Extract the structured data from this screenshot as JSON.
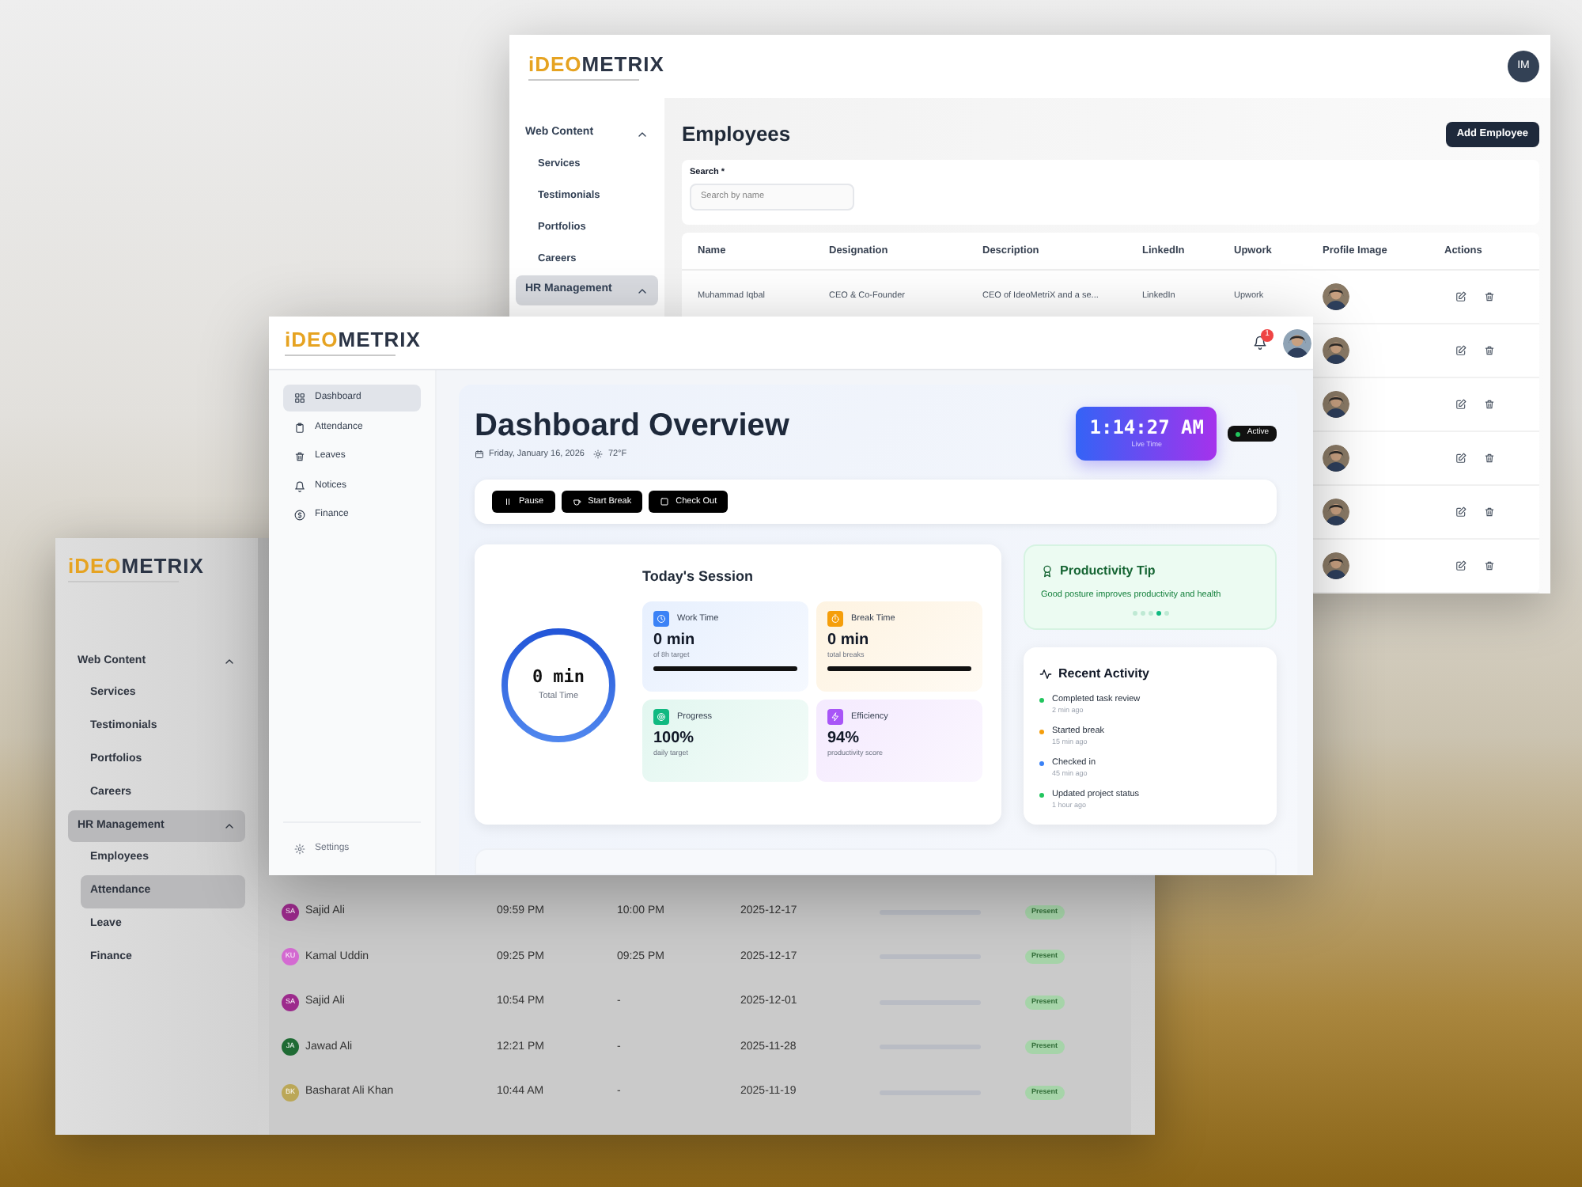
{
  "employees_window": {
    "logo": {
      "accent": "iDEO",
      "text": "METRIX"
    },
    "user_initials": "IM",
    "sidebar": [
      {
        "label": "Web Content",
        "expanded": true,
        "selected": false,
        "children": [
          {
            "label": "Services",
            "selected": false
          },
          {
            "label": "Testimonials",
            "selected": false
          },
          {
            "label": "Portfolios",
            "selected": false
          },
          {
            "label": "Careers",
            "selected": false
          }
        ]
      },
      {
        "label": "HR Management",
        "expanded": true,
        "selected": true
      }
    ],
    "title": "Employees",
    "add_button": "Add Employee",
    "search": {
      "label": "Search *",
      "placeholder": "Search by name"
    },
    "table": {
      "columns": [
        "Name",
        "Designation",
        "Description",
        "LinkedIn",
        "Upwork",
        "Profile Image",
        "Actions"
      ],
      "rows": [
        {
          "name": "Muhammad Iqbal",
          "designation": "CEO & Co-Founder",
          "description": "CEO of IdeoMetriX and a se...",
          "linkedin": "LinkedIn",
          "upwork": "Upwork",
          "profile_image": {
            "kind": "picture"
          }
        },
        {
          "profile_image": {
            "kind": "picture"
          }
        },
        {
          "profile_image": {
            "kind": "picture"
          }
        },
        {
          "profile_image": {
            "kind": "picture"
          }
        },
        {
          "profile_image": {
            "kind": "picture"
          }
        },
        {
          "profile_image": {
            "kind": "picture"
          }
        }
      ]
    }
  },
  "attendance_window": {
    "logo": {
      "accent": "iDEO",
      "text": "METRIX"
    },
    "sidebar": [
      {
        "label": "Web Content",
        "expanded": true,
        "selected": false,
        "children": [
          {
            "label": "Services",
            "selected": false
          },
          {
            "label": "Testimonials",
            "selected": false
          },
          {
            "label": "Portfolios",
            "selected": false
          },
          {
            "label": "Careers",
            "selected": false
          }
        ]
      },
      {
        "label": "HR Management",
        "expanded": true,
        "selected": true,
        "children": [
          {
            "label": "Employees",
            "selected": false
          },
          {
            "label": "Attendance",
            "selected": true
          },
          {
            "label": "Leave",
            "selected": false
          },
          {
            "label": "Finance",
            "selected": false
          }
        ]
      }
    ],
    "rows": [
      {
        "initials": "SA",
        "color": "#9c2a8c",
        "name": "Sajid Ali",
        "check_in": "09:59 PM",
        "check_out": "10:00 PM",
        "date": "2025-12-17",
        "level": 0,
        "status": "Present"
      },
      {
        "initials": "KU",
        "color": "#d46ad2",
        "name": "Kamal Uddin",
        "check_in": "09:25 PM",
        "check_out": "09:25 PM",
        "date": "2025-12-17",
        "level": 0,
        "status": "Present"
      },
      {
        "initials": "SA",
        "color": "#9c2a8c",
        "name": "Sajid Ali",
        "check_in": "10:54 PM",
        "check_out": "-",
        "date": "2025-12-01",
        "level": 0,
        "status": "Present"
      },
      {
        "initials": "JA",
        "color": "#1f6b34",
        "name": "Jawad Ali",
        "check_in": "12:21 PM",
        "check_out": "-",
        "date": "2025-11-28",
        "level": 0,
        "status": "Present"
      },
      {
        "initials": "BK",
        "color": "#bba757",
        "name": "Basharat Ali Khan",
        "check_in": "10:44 AM",
        "check_out": "-",
        "date": "2025-11-19",
        "level": 0,
        "status": "Present"
      }
    ]
  },
  "dashboard_window": {
    "logo": {
      "accent": "iDEO",
      "text": "METRIX"
    },
    "notifications": "1",
    "nav": [
      {
        "label": "Dashboard",
        "selected": true
      },
      {
        "label": "Attendance",
        "selected": false
      },
      {
        "label": "Leaves",
        "selected": false
      },
      {
        "label": "Notices",
        "selected": false
      },
      {
        "label": "Finance",
        "selected": false
      }
    ],
    "settings": "Settings",
    "title": "Dashboard Overview",
    "date": "Friday, January 16, 2026",
    "weather": "72°F",
    "clock": {
      "time": "1:14:27 AM",
      "label": "Live Time"
    },
    "status": {
      "label": "Active",
      "on": true
    },
    "actions": [
      "Pause",
      "Start Break",
      "Check Out"
    ],
    "session": {
      "title": "Today's Session",
      "total": "0 min",
      "total_label": "Total Time",
      "stats": [
        {
          "label": "Work Time",
          "value": "0 min",
          "caption": "of 8h target",
          "level": 1,
          "color": "#3b82f6"
        },
        {
          "label": "Break Time",
          "value": "0 min",
          "caption": "total breaks",
          "level": 1,
          "color": "#f59e0b"
        },
        {
          "label": "Progress",
          "value": "100%",
          "caption": "daily target",
          "color": "#10b981"
        },
        {
          "label": "Efficiency",
          "value": "94%",
          "caption": "productivity score",
          "color": "#a855f7"
        }
      ]
    },
    "tip": {
      "title": "Productivity Tip",
      "text": "Good posture improves productivity and health",
      "dots": [
        {
          "selected": false
        },
        {
          "selected": false
        },
        {
          "selected": false
        },
        {
          "selected": true
        },
        {
          "selected": false
        }
      ]
    },
    "activity": {
      "title": "Recent Activity",
      "items": [
        {
          "text": "Completed task review",
          "time": "2 min ago",
          "color": "#22c55e"
        },
        {
          "text": "Started break",
          "time": "15 min ago",
          "color": "#f59e0b"
        },
        {
          "text": "Checked in",
          "time": "45 min ago",
          "color": "#3b82f6"
        },
        {
          "text": "Updated project status",
          "time": "1 hour ago",
          "color": "#22c55e"
        }
      ]
    }
  }
}
